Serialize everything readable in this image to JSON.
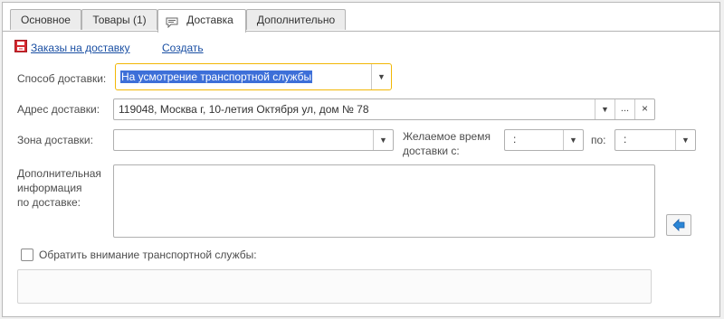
{
  "tabs": [
    {
      "label": "Основное"
    },
    {
      "label": "Товары (1)"
    },
    {
      "label": "Доставка"
    },
    {
      "label": "Дополнительно"
    }
  ],
  "links": {
    "orders": "Заказы на доставку",
    "create": "Создать"
  },
  "fields": {
    "method_label": "Способ доставки:",
    "method_value": "На усмотрение транспортной службы",
    "address_label": "Адрес доставки:",
    "address_value": "119048, Москва г, 10-летия Октября ул, дом № 78",
    "address_more": "...",
    "address_clear": "×",
    "zone_label": "Зона доставки:",
    "zone_value": "",
    "time_label_1": "Желаемое время",
    "time_label_2": "доставки с:",
    "time_from": ":",
    "to_label": "по:",
    "time_to": ":",
    "info_label_1": "Дополнительная",
    "info_label_2": "информация",
    "info_label_3": "по доставке:",
    "info_value": "",
    "attention_label": "Обратить внимание транспортной службы:",
    "attention_value": ""
  },
  "colors": {
    "focus_border": "#f2b705",
    "selection": "#3d6fd8",
    "link": "#1a4fa3"
  }
}
